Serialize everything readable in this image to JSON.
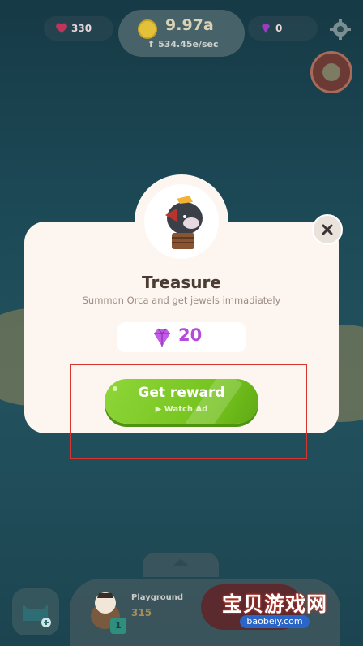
{
  "hud": {
    "hearts": "330",
    "coins": "9.97a",
    "rate": "534.45e/sec",
    "jewels": "0"
  },
  "modal": {
    "title": "Treasure",
    "subtitle": "Summon Orca and get jewels immadiately",
    "jewel_reward": "20",
    "button_label": "Get reward",
    "button_sub": "Watch Ad"
  },
  "bottom": {
    "area_title": "Playground",
    "area_value": "315",
    "level_badge": "1"
  },
  "watermark": {
    "logo": "宝贝游戏网",
    "url": "baobeiy.com"
  },
  "colors": {
    "accent_green": "#7ac41f",
    "jewel_purple": "#b44bdc",
    "highlight_red": "#d8352f"
  }
}
